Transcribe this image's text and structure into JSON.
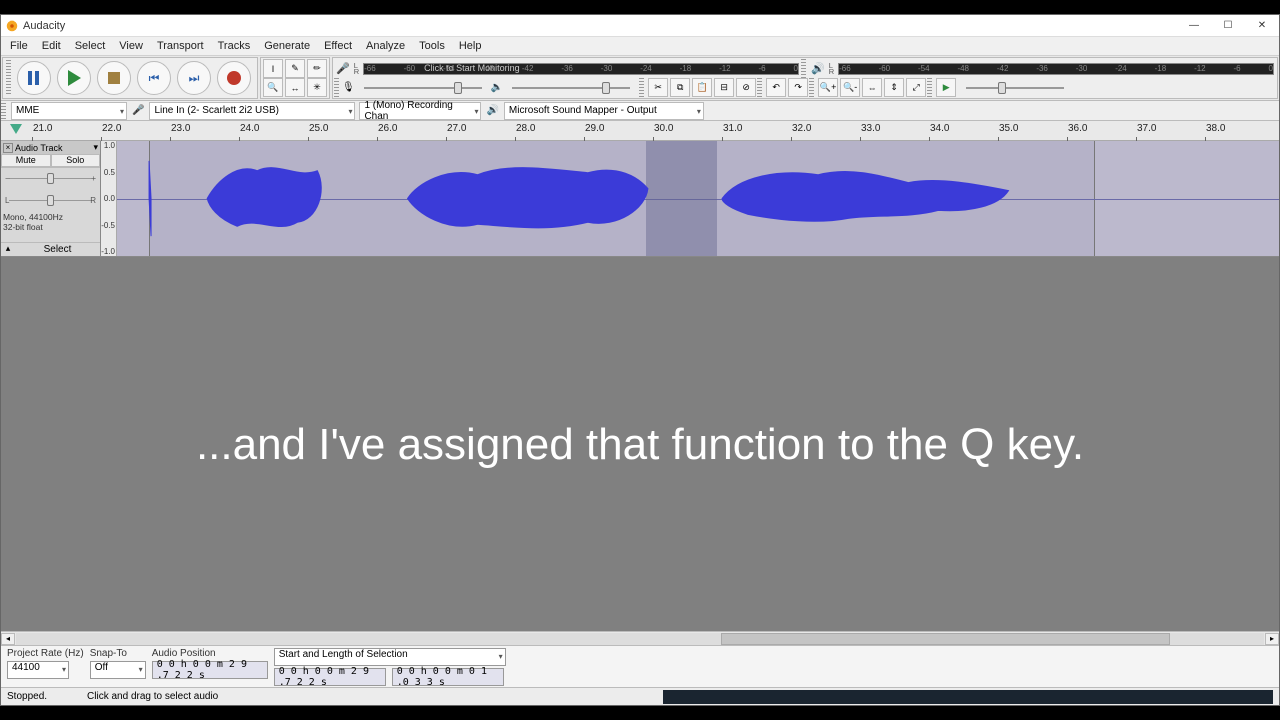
{
  "window": {
    "title": "Audacity"
  },
  "menu": [
    "File",
    "Edit",
    "Select",
    "View",
    "Transport",
    "Tracks",
    "Generate",
    "Effect",
    "Analyze",
    "Tools",
    "Help"
  ],
  "meters": {
    "rec_hint": "Click to Start Monitoring",
    "ticks": [
      "-66",
      "-60",
      "-54",
      "-48",
      "-42",
      "-36",
      "-30",
      "-24",
      "-18",
      "-12",
      "-6",
      "0"
    ]
  },
  "devices": {
    "host": "MME",
    "input": "Line In (2- Scarlett 2i2 USB)",
    "channels": "1 (Mono) Recording Chan",
    "output": "Microsoft Sound Mapper - Output"
  },
  "ruler": {
    "labels": [
      "21.0",
      "22.0",
      "23.0",
      "24.0",
      "25.0",
      "26.0",
      "27.0",
      "28.0",
      "29.0",
      "30.0",
      "31.0",
      "32.0",
      "33.0",
      "34.0",
      "35.0",
      "36.0",
      "37.0",
      "38.0"
    ]
  },
  "track": {
    "name": "Audio Track",
    "mute": "Mute",
    "solo": "Solo",
    "format1": "Mono, 44100Hz",
    "format2": "32-bit float",
    "select": "Select",
    "vscale": [
      "1.0",
      "0.5",
      "0.0",
      "-0.5",
      "-1.0"
    ]
  },
  "subtitle": "...and I've assigned that function to the Q key.",
  "selection_bar": {
    "project_rate_lbl": "Project Rate (Hz)",
    "project_rate": "44100",
    "snap_lbl": "Snap-To",
    "snap": "Off",
    "audio_pos_lbl": "Audio Position",
    "audio_pos": "0 0 h 0 0 m 2 9 .7 2 2 s",
    "mode_lbl": "Start and Length of Selection",
    "start": "0 0 h 0 0 m 2 9 .7 2 2 s",
    "length": "0 0 h 0 0 m 0 1 .0 3 3 s"
  },
  "status": {
    "state": "Stopped.",
    "hint": "Click and drag to select audio"
  }
}
